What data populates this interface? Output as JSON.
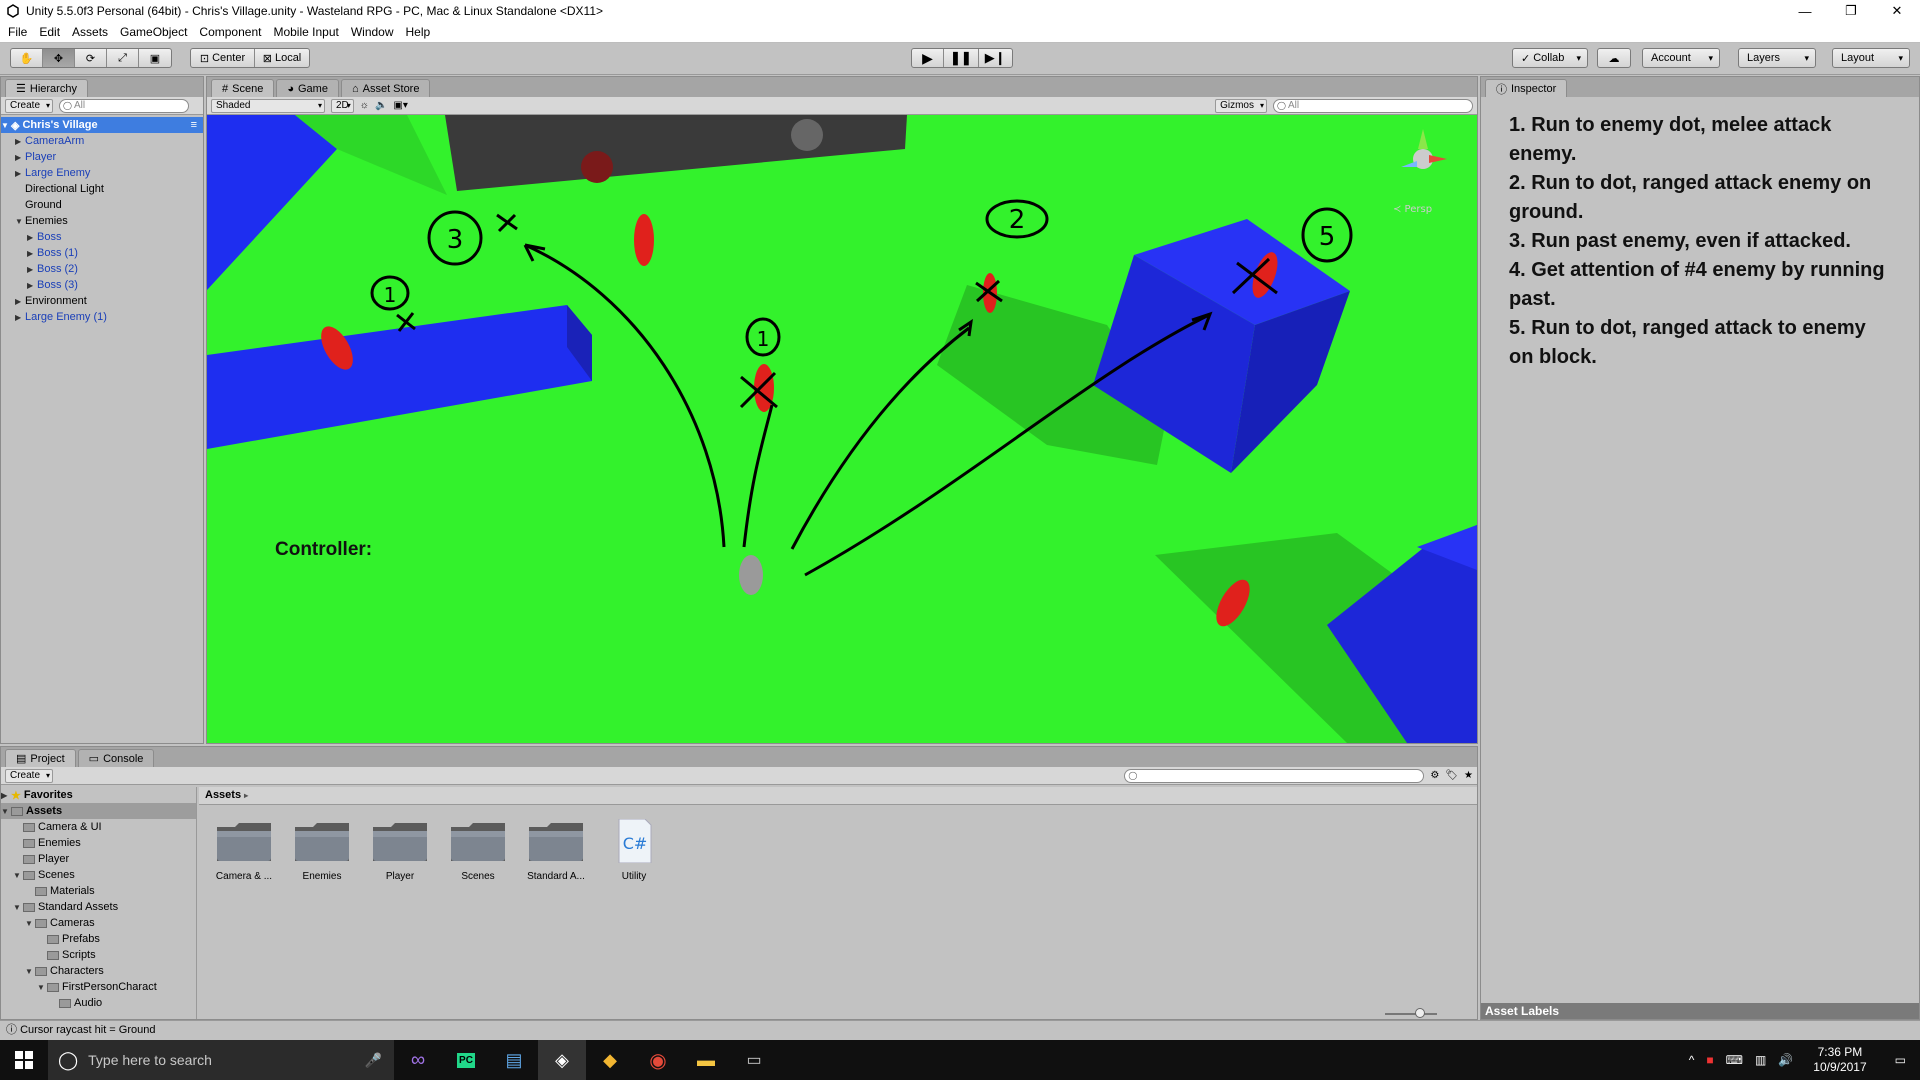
{
  "window": {
    "title": "Unity 5.5.0f3 Personal (64bit) - Chris's Village.unity - Wasteland RPG - PC, Mac & Linux Standalone <DX11>",
    "controls": [
      "—",
      "❐",
      "✕"
    ]
  },
  "menu": [
    "File",
    "Edit",
    "Assets",
    "GameObject",
    "Component",
    "Mobile Input",
    "Window",
    "Help"
  ],
  "toolbar": {
    "pivot": "Center",
    "space": "Local",
    "collab": "Collab",
    "account": "Account",
    "layers": "Layers",
    "layout": "Layout"
  },
  "hierarchy": {
    "tab": "Hierarchy",
    "create": "Create",
    "search_placeholder": "All",
    "scene_name": "Chris's Village",
    "items": [
      {
        "label": "CameraArm",
        "indent": 1,
        "arrow": "▶",
        "prefab": true
      },
      {
        "label": "Player",
        "indent": 1,
        "arrow": "▶",
        "prefab": true
      },
      {
        "label": "Large Enemy",
        "indent": 1,
        "arrow": "▶",
        "prefab": true
      },
      {
        "label": "Directional Light",
        "indent": 1,
        "arrow": "",
        "prefab": false
      },
      {
        "label": "Ground",
        "indent": 1,
        "arrow": "",
        "prefab": false
      },
      {
        "label": "Enemies",
        "indent": 1,
        "arrow": "▼",
        "prefab": false
      },
      {
        "label": "Boss",
        "indent": 2,
        "arrow": "▶",
        "prefab": true
      },
      {
        "label": "Boss (1)",
        "indent": 2,
        "arrow": "▶",
        "prefab": true
      },
      {
        "label": "Boss (2)",
        "indent": 2,
        "arrow": "▶",
        "prefab": true
      },
      {
        "label": "Boss (3)",
        "indent": 2,
        "arrow": "▶",
        "prefab": true
      },
      {
        "label": "Environment",
        "indent": 1,
        "arrow": "▶",
        "prefab": false
      },
      {
        "label": "Large Enemy (1)",
        "indent": 1,
        "arrow": "▶",
        "prefab": true
      }
    ]
  },
  "scene": {
    "tabs": [
      "Scene",
      "Game",
      "Asset Store"
    ],
    "shading": "Shaded",
    "mode_2d": "2D",
    "gizmos": "Gizmos",
    "search_placeholder": "All",
    "persp_label": "≺ Persp",
    "controller_label": "Controller:",
    "annotations": [
      "3",
      "1",
      "1",
      "2",
      "5"
    ]
  },
  "inspector": {
    "tab": "Inspector",
    "notes": [
      "1. Run to enemy dot, melee attack enemy.",
      "2. Run to dot, ranged attack enemy on ground.",
      "3. Run past enemy, even if attacked.",
      "4. Get attention of #4 enemy by running past.",
      "5. Run to dot, ranged attack to enemy on block."
    ],
    "asset_labels": "Asset Labels"
  },
  "project": {
    "tabs": [
      "Project",
      "Console"
    ],
    "create": "Create",
    "favorites": "Favorites",
    "tree": [
      {
        "label": "Assets",
        "indent": 0,
        "arrow": "▼",
        "bold": true,
        "selected": true
      },
      {
        "label": "Camera & UI",
        "indent": 1,
        "arrow": "",
        "bold": false
      },
      {
        "label": "Enemies",
        "indent": 1,
        "arrow": "",
        "bold": false
      },
      {
        "label": "Player",
        "indent": 1,
        "arrow": "",
        "bold": false
      },
      {
        "label": "Scenes",
        "indent": 1,
        "arrow": "▼",
        "bold": false
      },
      {
        "label": "Materials",
        "indent": 2,
        "arrow": "",
        "bold": false
      },
      {
        "label": "Standard Assets",
        "indent": 1,
        "arrow": "▼",
        "bold": false
      },
      {
        "label": "Cameras",
        "indent": 2,
        "arrow": "▼",
        "bold": false
      },
      {
        "label": "Prefabs",
        "indent": 3,
        "arrow": "",
        "bold": false
      },
      {
        "label": "Scripts",
        "indent": 3,
        "arrow": "",
        "bold": false
      },
      {
        "label": "Characters",
        "indent": 2,
        "arrow": "▼",
        "bold": false
      },
      {
        "label": "FirstPersonCharact",
        "indent": 3,
        "arrow": "▼",
        "bold": false
      },
      {
        "label": "Audio",
        "indent": 4,
        "arrow": "",
        "bold": false
      }
    ],
    "breadcrumb": "Assets",
    "assets": [
      {
        "label": "Camera & ...",
        "type": "folder"
      },
      {
        "label": "Enemies",
        "type": "folder"
      },
      {
        "label": "Player",
        "type": "folder"
      },
      {
        "label": "Scenes",
        "type": "folder"
      },
      {
        "label": "Standard A...",
        "type": "folder"
      },
      {
        "label": "Utility",
        "type": "script"
      }
    ]
  },
  "status": "Cursor raycast hit = Ground",
  "taskbar": {
    "search_placeholder": "Type here to search",
    "time": "7:36 PM",
    "date": "10/9/2017"
  }
}
